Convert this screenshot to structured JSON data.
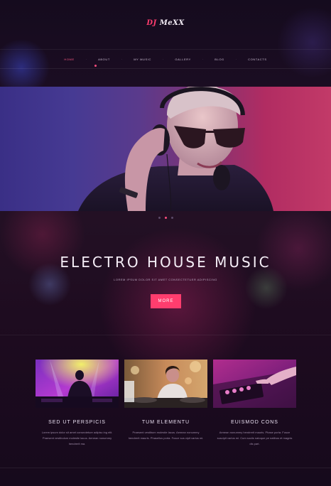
{
  "brand": {
    "dj": "DJ",
    "name": "MeXX",
    "accent": "#ff3d6e"
  },
  "nav": {
    "items": [
      "HOME",
      "ABOUT",
      "MY MUSIC",
      "GALLERY",
      "BLOG",
      "CONTACTS"
    ],
    "separator": "·",
    "active_index": 0
  },
  "hero": {
    "image": "dj-with-headphones-photo",
    "slides": 3,
    "active_slide": 1
  },
  "intro": {
    "headline": "ELECTRO HOUSE MUSIC",
    "subline": "LOREM IPSUM DOLOR SIT AMET CONSECTETUER ADIPISCING",
    "button_label": "MORE"
  },
  "cards": [
    {
      "image": "dj-on-stage-photo",
      "title": "SED UT PERSPICIS",
      "desc": "Lorem ipsum dolor sit amet consectetuer adipisc ing elit. Praesent vestibulum molestie lacus. Aenean nonummy hendrerit ma."
    },
    {
      "image": "female-dj-turntables-photo",
      "title": "TUM ELEMENTU",
      "desc": "Praesent vestibum molestie lacus. Aenean nonummy hendrerit mauris. Phasellus porta. Fusce sus cipit varius mi."
    },
    {
      "image": "dj-mixer-hands-photo",
      "title": "EUISMOD CONS",
      "desc": "Aenean nonummy hendrerit mauris. Phase porta. Fusce suscipit varius mi. Cum sociis natoque pe natibus et magnis dis part."
    }
  ]
}
